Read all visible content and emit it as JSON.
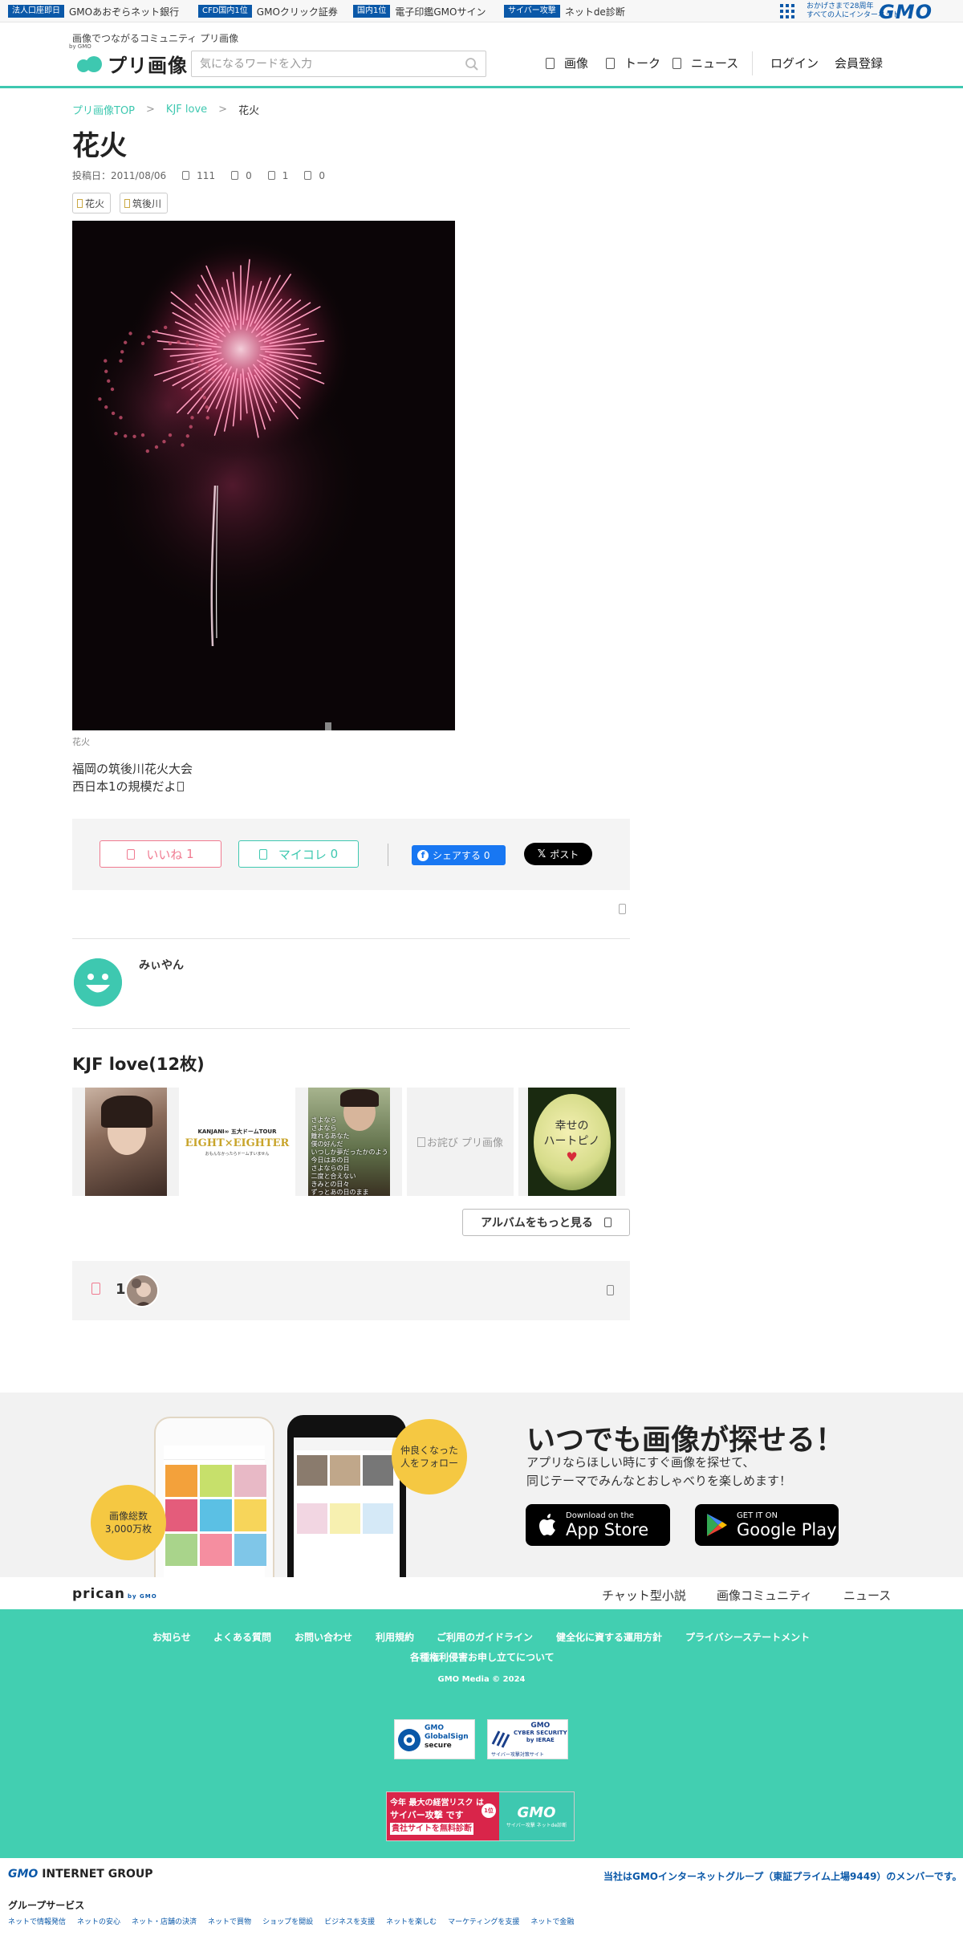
{
  "gmo_bar": {
    "items": [
      {
        "badge": "法人口座即日",
        "text": "GMOあおぞらネット銀行"
      },
      {
        "badge": "CFD国内1位",
        "text": "GMOクリック証券"
      },
      {
        "badge": "国内1位",
        "text": "電子印鑑GMOサイン"
      },
      {
        "badge": "サイバー攻撃",
        "text": "ネットde診断"
      }
    ],
    "tagline_1": "おかげさまで28周年",
    "tagline_2": "すべての人にインターネット",
    "logo": "GMO"
  },
  "header": {
    "tagline": "画像でつながるコミュニティ プリ画像",
    "logo_text": "プリ画像",
    "logo_sub": "by GMO",
    "search_placeholder": "気になるワードを入力",
    "nav": {
      "images": "画像",
      "talk": "トーク",
      "news": "ニュース",
      "login": "ログイン",
      "register": "会員登録"
    }
  },
  "breadcrumb": {
    "home": "プリ画像TOP",
    "sep": ">",
    "album": "KJF love",
    "current": "花火"
  },
  "post": {
    "title": "花火",
    "posted": "投稿日：2011/08/06",
    "stats": {
      "views": "111",
      "comments": "0",
      "likes": "1",
      "mycolle": "0"
    },
    "tags": [
      "花火",
      "筑後川"
    ],
    "caption": "花火",
    "description_line1": "福岡の筑後川花火大会",
    "description_line2": "西日本1の規模だよ"
  },
  "actions": {
    "like_label": "いいね",
    "like_count": "1",
    "mycolle_label": "マイコレ",
    "mycolle_count": "0",
    "fb_label": "シェアする 0",
    "x_label": "ポスト"
  },
  "user": {
    "name": "みぃやん"
  },
  "album": {
    "title": "KJF love(12枚)",
    "thumb_texts": {
      "tour_line1": "KANJANI∞ 五大ドームTOUR",
      "tour_line2": "EIGHT×EIGHTER",
      "tour_line3": "おもんなかったらドームすいません",
      "poem": "さよなら\nさよなら\n離れるあなた\n僕の好んだ\nいつしか夢だったかのよう\n今日はあの日\nさよならの日\n二度と合えない\nきみとの日々\nずっとあの日のまま",
      "alt": "お詫び プリ画像",
      "happy_line1": "幸せの",
      "happy_line2": "ハートピノ"
    },
    "more_button": "アルバムをもっと見る"
  },
  "likes": {
    "count": "1"
  },
  "app_promo": {
    "headline": "いつでも画像が探せる！",
    "sub_line1": "アプリならほしい時にすぐ画像を探せて、",
    "sub_line2": "同じテーマでみんなとおしゃべりを楽しめます！",
    "bubble_left_1": "画像総数",
    "bubble_left_2": "3,000万枚",
    "bubble_right_1": "仲良くなった",
    "bubble_right_2": "人をフォロー",
    "appstore_small": "Download on the",
    "appstore_big": "App Store",
    "googleplay_small": "GET IT ON",
    "googleplay_big": "Google Play"
  },
  "pricain": {
    "logo": "prican",
    "logo_sub": "by GMO",
    "links": [
      "チャット型小説",
      "画像コミュニティ",
      "ニュース"
    ]
  },
  "footer": {
    "links": [
      "お知らせ",
      "よくある質問",
      "お問い合わせ",
      "利用規約",
      "ご利用のガイドライン",
      "健全化に資する運用方針",
      "プライバシーステートメント",
      "各種権利侵害お申し立てについて"
    ],
    "copyright": "GMO Media © 2024",
    "seal1_brand": "GMO",
    "seal1_line1": "GlobalSign",
    "seal1_line2": "secure",
    "seal2_brand": "GMO",
    "seal2_line1": "CYBER SECURITY",
    "seal2_line2": "by IERAE",
    "seal2_line3": "サイバー攻撃対策サイト",
    "cyber_line1": "今年 最大の経営リスク は",
    "cyber_line2": "サイバー攻撃 です",
    "cyber_line3": "貴社サイトを無料診断",
    "cyber_rank": "1位",
    "cyber_brand": "GMO",
    "cyber_tag": "サイバー攻撃 ネットde診断"
  },
  "group_footer": {
    "logo_brand": "GMO",
    "logo_text": "INTERNET GROUP",
    "member_text": "当社はGMOインターネットグループ（東証プライム上場9449）のメンバーです。",
    "services_label": "グループサービス",
    "services": [
      "ネットで情報発信",
      "ネットの安心",
      "ネット・店舗の決済",
      "ネットで買物",
      "ショップを開設",
      "ビジネスを支援",
      "ネットを楽しむ",
      "マーケティングを支援",
      "ネットで金融"
    ]
  },
  "colors": {
    "accent": "#3ec8b0",
    "like": "#f07a90",
    "gmo_blue": "#0a58a8",
    "facebook": "#1877f2"
  }
}
